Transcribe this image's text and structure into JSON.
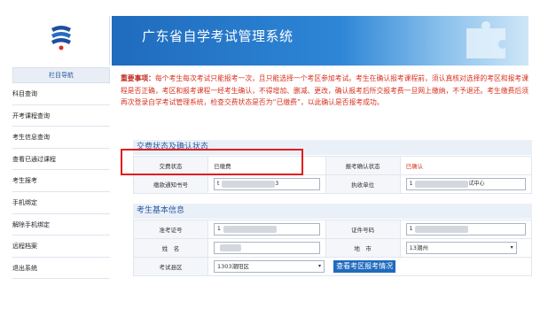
{
  "header": {
    "title": "广东省自学考试管理系统"
  },
  "sidebar": {
    "heading": "栏目导航",
    "items": [
      {
        "label": "科目查询"
      },
      {
        "label": "开考课程查询"
      },
      {
        "label": "考生信息查询"
      },
      {
        "label": "查看已通过课程"
      },
      {
        "label": "考生报考"
      },
      {
        "label": "手机绑定"
      },
      {
        "label": "解除手机绑定"
      },
      {
        "label": "远程档案"
      },
      {
        "label": "退出系统"
      }
    ]
  },
  "notice": {
    "heading": "重要事项：",
    "text": "每个考生每次考试只能报考一次，且只能选择一个考区参加考试。考生在确认报考课程前，须认真核对选择的考区和报考课程是否正确，考区和报考课程一经考生确认，不得增加、删减、更改，确认报考后所交报考费一旦网上缴纳，不予退还。考生缴费后须再次登录自学考试管理系统，检查交费状态是否为“已缴费”，以此确认是否报考成功。"
  },
  "fee_section": {
    "title": "交费状态及确认状态",
    "fee_status_label": "交费状态",
    "fee_status_value": "已缴费",
    "confirm_status_label": "报考确认状态",
    "confirm_status_value": "已确认",
    "notice_no_label": "缴款通知书号",
    "notice_no_value": "t",
    "notice_no_suffix": "3",
    "receiver_label": "执收单位",
    "receiver_value": "1",
    "receiver_suffix": "试中心"
  },
  "basic_section": {
    "title": "考生基本信息",
    "exam_no_label": "准考证号",
    "exam_no_value": "1",
    "id_no_label": "证件号码",
    "id_no_value": "1",
    "name_label": "姓　名",
    "name_value": "",
    "city_label": "地　市",
    "city_value": "13潮州",
    "district_label": "考试县区",
    "district_value": "1303潮阳区",
    "check_button": "查看考区报考情况"
  },
  "colors": {
    "banner": "#1f6bbd",
    "notice_text": "#d8301e",
    "highlight": "#e11d1d"
  }
}
